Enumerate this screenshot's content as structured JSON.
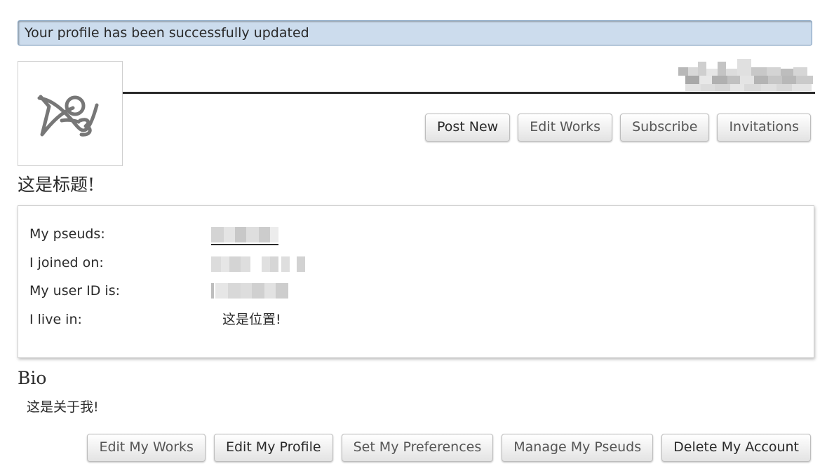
{
  "flash": {
    "message": "Your profile has been successfully updated"
  },
  "header": {
    "avatar_icon": "ao3-logo-icon",
    "nav": {
      "post_new": "Post New",
      "edit_works": "Edit Works",
      "subscribe": "Subscribe",
      "invitations": "Invitations"
    }
  },
  "profile": {
    "title": "这是标题!",
    "meta": {
      "pseuds_label": "My pseuds:",
      "joined_label": "I joined on:",
      "user_id_label": "My user ID is:",
      "location_label": "I live in:",
      "location_value": "这是位置!"
    },
    "bio_heading": "Bio",
    "bio_text": "这是关于我!"
  },
  "actions": {
    "edit_my_works": "Edit My Works",
    "edit_my_profile": "Edit My Profile",
    "set_my_preferences": "Set My Preferences",
    "manage_my_pseuds": "Manage My Pseuds",
    "delete_my_account": "Delete My Account"
  },
  "colors": {
    "flash_background": "#ccdced",
    "header_rule": "#2a2a2a",
    "text": "#2a2a2a"
  }
}
